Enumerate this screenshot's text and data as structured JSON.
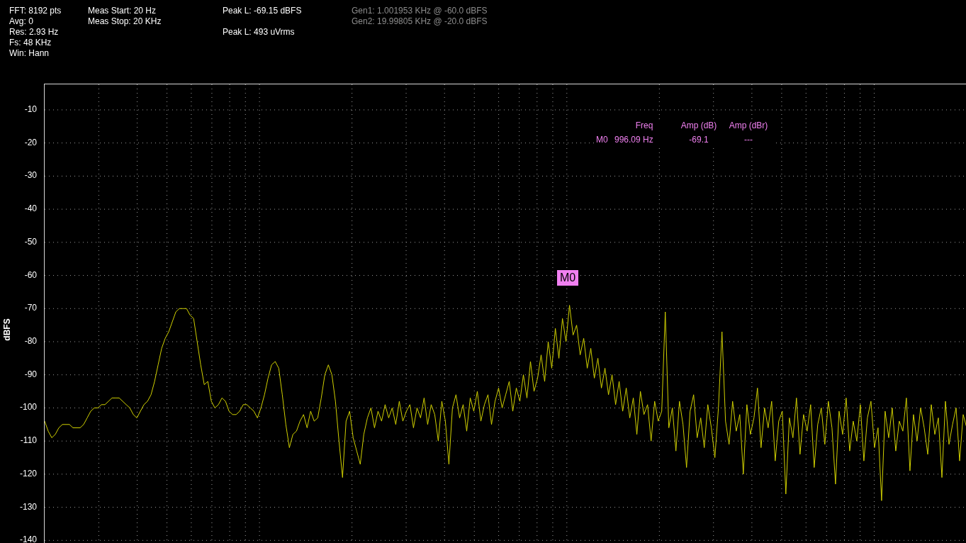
{
  "header": {
    "settings": [
      "FFT: 8192 pts",
      "Avg: 0",
      "Res: 2.93 Hz",
      "Fs: 48 KHz",
      "Win: Hann"
    ],
    "range": [
      "Meas Start: 20 Hz",
      "Meas Stop: 20 KHz"
    ],
    "peaks": [
      "Peak L: -69.15 dBFS",
      "Peak L: 493 uVrms"
    ],
    "generators": [
      "Gen1: 1.001953 KHz @ -60.0 dBFS",
      "Gen2: 19.99805 KHz @ -20.0 dBFS"
    ]
  },
  "plot": {
    "chart_data": {
      "type": "line",
      "grid": true,
      "ylabel": "dBFS",
      "categories": [
        null,
        null,
        null,
        null,
        null,
        null,
        null,
        null,
        null,
        null,
        null,
        null,
        null,
        null,
        null,
        null,
        null,
        null,
        null,
        null,
        null,
        null,
        null,
        null,
        null,
        null,
        null,
        null,
        null,
        null,
        null,
        null,
        null,
        null,
        null,
        null,
        null,
        null,
        null,
        null,
        null,
        null,
        null,
        null,
        null,
        null,
        null,
        null,
        null,
        null,
        null,
        null,
        null,
        null,
        null,
        null,
        null,
        null,
        null,
        null,
        null,
        null,
        null,
        null,
        null,
        null,
        null,
        null,
        null,
        null,
        null,
        null,
        null,
        null,
        null,
        null,
        null,
        null,
        null,
        null,
        null,
        null,
        null,
        null,
        null,
        null,
        null,
        null,
        null,
        null,
        null,
        null,
        null,
        null,
        null,
        null,
        null,
        null,
        null,
        null,
        null,
        null,
        null,
        null,
        null,
        null,
        null,
        null,
        null,
        null,
        null,
        null,
        null,
        null,
        null,
        null,
        null,
        null,
        null,
        null,
        null,
        null,
        null,
        null,
        null,
        null,
        null,
        null,
        null,
        null,
        null,
        null,
        null,
        null,
        null,
        null,
        null,
        null,
        null,
        null,
        null,
        null,
        null,
        null,
        null,
        null,
        null,
        null,
        null,
        null,
        null,
        null,
        null,
        null,
        null,
        null,
        null,
        null,
        null,
        null,
        null,
        null,
        null,
        null,
        null,
        null,
        null,
        null,
        null,
        null,
        null,
        null,
        null,
        null,
        null,
        null,
        null,
        null,
        null,
        null,
        null,
        null,
        null,
        null,
        null,
        null,
        null,
        null,
        null,
        null,
        null,
        null,
        null,
        null,
        null,
        null,
        null,
        null,
        null,
        null,
        null,
        null,
        null,
        null,
        null,
        null,
        null,
        null,
        null,
        null,
        null,
        null,
        null,
        null,
        null,
        null,
        null,
        null,
        null,
        null,
        null,
        null,
        null,
        null,
        null,
        null,
        null,
        null,
        null,
        null,
        null,
        null,
        null,
        null,
        null,
        null,
        null,
        null,
        null,
        null,
        null,
        null,
        null,
        null,
        null,
        null,
        null,
        null,
        null,
        null,
        null,
        null,
        null,
        null,
        null,
        null,
        null,
        null,
        null,
        null,
        null
      ],
      "ylim": [
        -141,
        -2.3
      ],
      "yticks": [
        -10,
        -20,
        -30,
        -40,
        -50,
        -60,
        -70,
        -80,
        -90,
        -100,
        -110,
        -120,
        -130,
        -140
      ],
      "series": [
        {
          "color": "#d0d000",
          "values": [
            -104,
            -107,
            -109,
            -108,
            -106,
            -105,
            -105,
            -105,
            -106,
            -106,
            -106,
            -105,
            -103,
            -101,
            -100,
            -100,
            -99,
            -99,
            -98,
            -97,
            -97,
            -97,
            -98,
            -99,
            -100,
            -102,
            -103,
            -101,
            -99,
            -98,
            -96,
            -92,
            -87,
            -82,
            -79,
            -77,
            -74,
            -71,
            -70,
            -70,
            -70,
            -72,
            -73,
            -80,
            -87,
            -93,
            -92,
            -98,
            -100,
            -99,
            -97,
            -98,
            -101,
            -102,
            -102,
            -101,
            -99,
            -99,
            -100,
            -101,
            -103,
            -100,
            -96,
            -91,
            -87,
            -86,
            -88,
            -96,
            -105,
            -112,
            -108,
            -107,
            -104,
            -102,
            -106,
            -101,
            -104,
            -103,
            -97,
            -90,
            -87,
            -90,
            -98,
            -110,
            -121,
            -104,
            -101,
            -109,
            -113,
            -117,
            -108,
            -103,
            -100,
            -106,
            -101,
            -104,
            -99,
            -103,
            -100,
            -105,
            -98,
            -104,
            -101,
            -99,
            -106,
            -100,
            -103,
            -97,
            -105,
            -99,
            -102,
            -110,
            -98,
            -104,
            -117,
            -100,
            -96,
            -103,
            -99,
            -107,
            -97,
            -101,
            -95,
            -104,
            -99,
            -96,
            -105,
            -98,
            -94,
            -100,
            -96,
            -92,
            -101,
            -94,
            -98,
            -90,
            -97,
            -86,
            -95,
            -91,
            -84,
            -92,
            -80,
            -88,
            -76,
            -85,
            -73,
            -80,
            -69,
            -78,
            -75,
            -84,
            -79,
            -88,
            -82,
            -91,
            -85,
            -94,
            -88,
            -96,
            -90,
            -99,
            -92,
            -101,
            -94,
            -103,
            -97,
            -108,
            -95,
            -102,
            -99,
            -110,
            -98,
            -104,
            -101,
            -71,
            -106,
            -100,
            -113,
            -98,
            -105,
            -118,
            -101,
            -96,
            -109,
            -103,
            -112,
            -99,
            -106,
            -115,
            -100,
            -77,
            -104,
            -111,
            -98,
            -107,
            -102,
            -120,
            -99,
            -108,
            -103,
            -94,
            -112,
            -100,
            -106,
            -98,
            -116,
            -104,
            -101,
            -126,
            -103,
            -109,
            -97,
            -114,
            -102,
            -107,
            -99,
            -118,
            -105,
            -100,
            -111,
            -98,
            -106,
            -123,
            -101,
            -108,
            -97,
            -113,
            -104,
            -110,
            -99,
            -116,
            -103,
            -98,
            -112,
            -106,
            -128,
            -101,
            -109,
            -100,
            -113,
            -104,
            -107,
            -97,
            -119,
            -102,
            -110,
            -100,
            -106,
            -114,
            -99,
            -108,
            -103,
            -121,
            -98,
            -111,
            -105,
            -100,
            -116,
            -102,
            -106
          ]
        }
      ]
    },
    "marker_table": {
      "columns": [
        "Freq",
        "Amp (dB)",
        "Amp (dBr)"
      ],
      "rows": [
        {
          "name": "M0",
          "freq": "996.09 Hz",
          "amp_db": "-69.1",
          "amp_dbr": "---"
        }
      ]
    },
    "markers": [
      {
        "label": "M0"
      }
    ]
  }
}
